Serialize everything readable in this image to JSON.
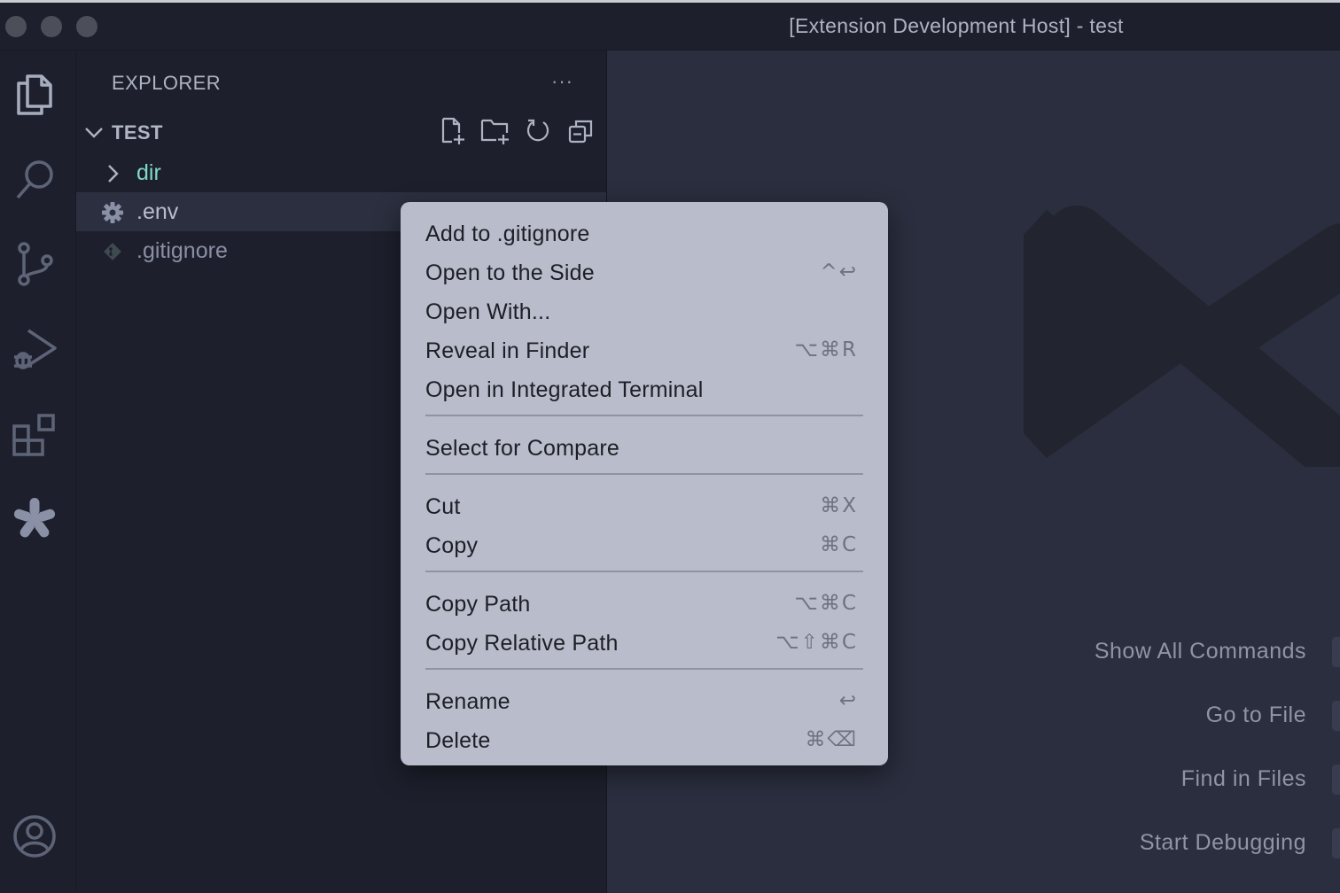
{
  "window": {
    "title": "[Extension Development Host] - test"
  },
  "activity_bar": {
    "items": [
      {
        "icon": "files-icon",
        "active": true
      },
      {
        "icon": "search-icon"
      },
      {
        "icon": "source-control-icon"
      },
      {
        "icon": "run-debug-icon"
      },
      {
        "icon": "extensions-icon"
      },
      {
        "icon": "asterisk-icon"
      },
      {
        "icon": "account-icon"
      }
    ]
  },
  "sidebar": {
    "title": "EXPLORER",
    "more": "···",
    "section": {
      "label": "TEST",
      "actions": [
        "new-file-icon",
        "new-folder-icon",
        "refresh-icon",
        "collapse-all-icon"
      ]
    },
    "tree": [
      {
        "name": "dir",
        "type": "folder",
        "color": "#7fd8c7"
      },
      {
        "name": ".env",
        "type": "file",
        "color": "#b8bdcc",
        "selected": true
      },
      {
        "name": ".gitignore",
        "type": "file",
        "color": "#8a8fa6"
      }
    ]
  },
  "context_menu": {
    "items": [
      {
        "label": "Add to .gitignore",
        "shortcut": ""
      },
      {
        "label": "Open to the Side",
        "shortcut": "^↩"
      },
      {
        "label": "Open With...",
        "shortcut": ""
      },
      {
        "label": "Reveal in Finder",
        "shortcut": "⌥⌘R"
      },
      {
        "label": "Open in Integrated Terminal",
        "shortcut": ""
      },
      {
        "label": "Select for Compare",
        "shortcut": ""
      },
      {
        "label": "Cut",
        "shortcut": "⌘X"
      },
      {
        "label": "Copy",
        "shortcut": "⌘C"
      },
      {
        "label": "Copy Path",
        "shortcut": "⌥⌘C"
      },
      {
        "label": "Copy Relative Path",
        "shortcut": "⌥⇧⌘C"
      },
      {
        "label": "Rename",
        "shortcut": "↩"
      },
      {
        "label": "Delete",
        "shortcut": "⌘⌫"
      }
    ]
  },
  "editor": {
    "watermark_shortcuts": [
      "Show All Commands",
      "Go to File",
      "Find in Files",
      "Start Debugging"
    ]
  },
  "colors": {
    "accent_folder": "#7fd8c7",
    "menu_background": "#b8bccb",
    "sidebar_background": "#1d202c",
    "editor_background": "#2a2e3e"
  }
}
